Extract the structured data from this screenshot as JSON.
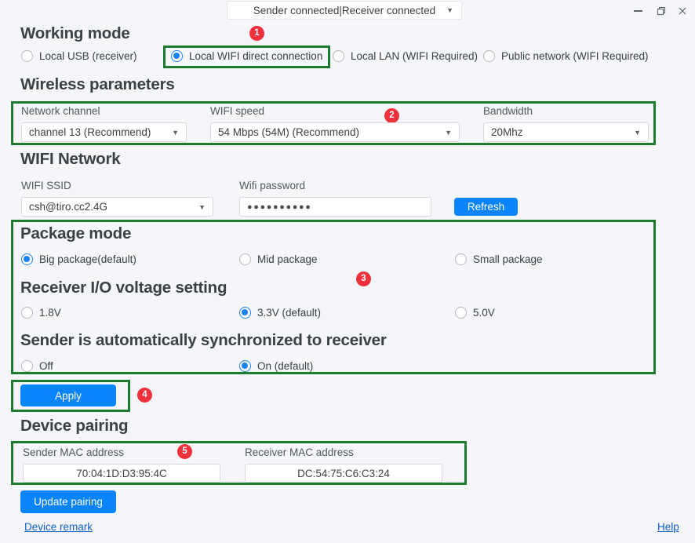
{
  "window": {
    "status_text": "Sender connected|Receiver connected",
    "minimize_label": "—",
    "restore_label": "❐",
    "close_label": "✕",
    "caret": "▼"
  },
  "working_mode": {
    "heading": "Working mode",
    "badge": "1",
    "options": [
      {
        "label": "Local USB (receiver)",
        "checked": false
      },
      {
        "label": "Local WIFI direct connection",
        "checked": true
      },
      {
        "label": "Local LAN (WIFI Required)",
        "checked": false
      },
      {
        "label": "Public network (WIFI Required)",
        "checked": false
      }
    ]
  },
  "wireless_parameters": {
    "heading": "Wireless parameters",
    "badge": "2",
    "fields": [
      {
        "label": "Network channel",
        "value": "channel 13 (Recommend)"
      },
      {
        "label": "WIFI speed",
        "value": "54 Mbps (54M)  (Recommend)"
      },
      {
        "label": "Bandwidth",
        "value": "20Mhz"
      }
    ]
  },
  "wifi_network": {
    "heading": "WIFI Network",
    "ssid_label": "WIFI SSID",
    "ssid_value": "csh@tiro.cc2.4G",
    "password_label": "Wifi password",
    "password_value": "●●●●●●●●●●",
    "refresh_label": "Refresh"
  },
  "package_mode": {
    "heading": "Package mode",
    "badge": "3",
    "options": [
      {
        "label": "Big package(default)",
        "checked": true
      },
      {
        "label": "Mid package",
        "checked": false
      },
      {
        "label": "Small package",
        "checked": false
      }
    ]
  },
  "voltage_setting": {
    "heading": "Receiver I/O voltage setting",
    "options": [
      {
        "label": "1.8V",
        "checked": false
      },
      {
        "label": "3.3V (default)",
        "checked": true
      },
      {
        "label": "5.0V",
        "checked": false
      }
    ]
  },
  "auto_sync": {
    "heading": "Sender is automatically synchronized to receiver",
    "options": [
      {
        "label": "Off",
        "checked": false
      },
      {
        "label": "On (default)",
        "checked": true
      }
    ]
  },
  "apply": {
    "label": "Apply",
    "badge": "4"
  },
  "device_pairing": {
    "heading": "Device pairing",
    "badge": "5",
    "sender_label": "Sender MAC address",
    "sender_value": "70:04:1D:D3:95:4C",
    "receiver_label": "Receiver MAC address",
    "receiver_value": "DC:54:75:C6:C3:24",
    "update_label": "Update pairing"
  },
  "footer": {
    "device_remark": "Device remark",
    "help": "Help"
  },
  "colors": {
    "accent": "#0a84fb",
    "highlight_border": "#1d7a2e",
    "badge": "#f0313b",
    "background": "#f4f6f9",
    "link": "#1060c9"
  }
}
